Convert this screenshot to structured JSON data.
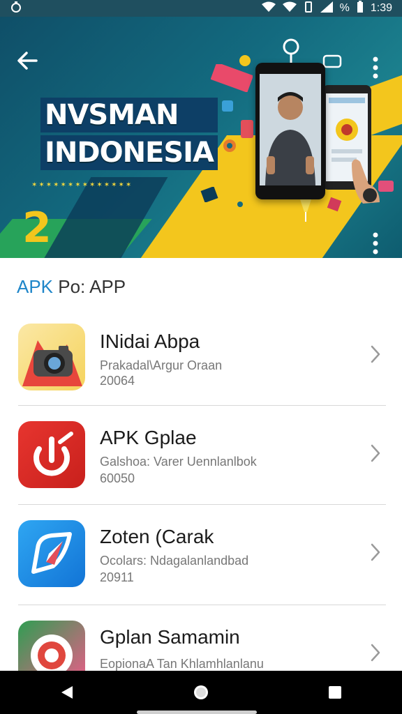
{
  "status_bar": {
    "time": "1:39",
    "battery_label": "%"
  },
  "banner": {
    "title_line1": "NVSMAN",
    "title_line2": "INDONESIA",
    "number": "2",
    "dots": "✶✶✶✶✶✶✶✶✶✶✶✶✶✶"
  },
  "section": {
    "prefix": "APK",
    "suffix": " Po: APP"
  },
  "apps": [
    {
      "title": "INidai Abpa",
      "subtitle": "Prakadal\\Argur Oraan",
      "number": "20064",
      "icon": "camera-icon"
    },
    {
      "title": "APK Gplae",
      "subtitle": "Galshoa: Varer Uennlanlbok",
      "number": "60050",
      "icon": "power-icon"
    },
    {
      "title": "Zoten (Carak",
      "subtitle": "Ocolars: Ndagalanlandbad",
      "number": "20911",
      "icon": "compass-icon"
    },
    {
      "title": "Gplan Samamin",
      "subtitle": "EopionaA Tan Khlamhlanlanu",
      "number": "",
      "icon": "chrome-icon"
    }
  ],
  "colors": {
    "accent": "#1f86c9",
    "banner_blue": "#136a7f",
    "banner_yellow": "#f3c61d"
  }
}
